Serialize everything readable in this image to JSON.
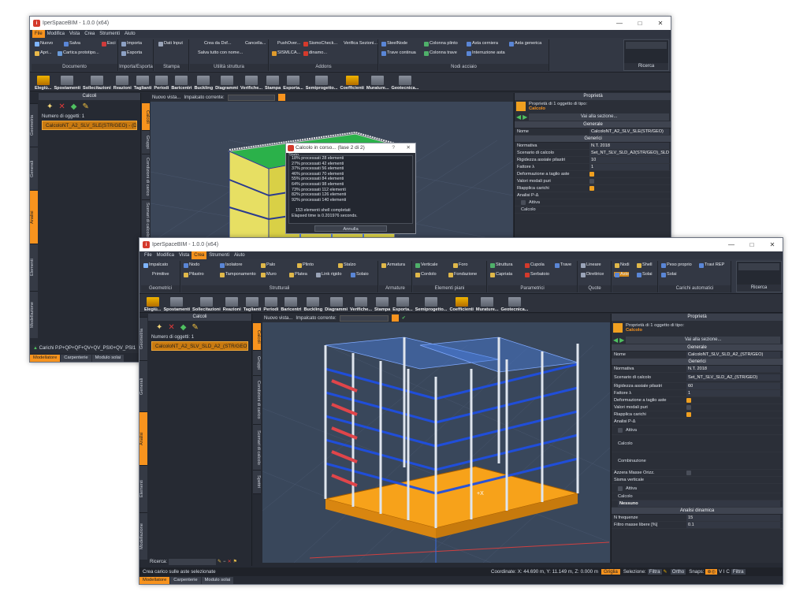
{
  "w1": {
    "title": "IperSpaceBIM - 1.0.0 (x64)",
    "menu": [
      "File",
      "Modifica",
      "Vista",
      "Crea",
      "Strumenti",
      "Aiuto"
    ],
    "ribbon_groups": [
      {
        "label": "Documento",
        "items": [
          "Nuovo",
          "Salva",
          "Esci",
          "Apri...",
          "Cartica prototipo..."
        ]
      },
      {
        "label": "Importa/Esporta",
        "items": [
          "Importa",
          "Esporta"
        ]
      },
      {
        "label": "Stampa",
        "items": [
          "Dati Input"
        ]
      },
      {
        "label": "Utilità struttura",
        "items": [
          "Crea da Dxf...",
          "Cancella...",
          "Salva tutto con nome..."
        ]
      },
      {
        "label": "Addons",
        "items": [
          "PushOver...",
          "SismoCheck...",
          "Verifica Sezioni...",
          "SISMLCA...",
          "dinamo..."
        ]
      },
      {
        "label": "Nodi acciaio",
        "items": [
          "SteelNode",
          "Colonna plinto",
          "Asta cerniera",
          "Asta generica",
          "Trave continua",
          "Colonna trave",
          "Interruzione asta"
        ]
      }
    ],
    "search_label": "Ricerca",
    "toolbar": [
      "Elegiù...",
      "Spostamenti",
      "Sollecitazioni",
      "Reazioni",
      "Taglianti",
      "Periodi",
      "Baricentri",
      "Buckling",
      "Diagrammi",
      "Verifiche...",
      "Stampa",
      "Esporta...",
      "Semiprogetto...",
      "Coefficienti",
      "Murature...",
      "Geotecnica..."
    ],
    "left_panel_title": "Calcoli",
    "left_vtabs": [
      "Geometria",
      "Generali",
      "Analisi",
      "Elementi",
      "Modellazione"
    ],
    "left_vtabs2": [
      "Calcoli",
      "Gruppi",
      "Condizioni di carico",
      "Scenari di calcolo"
    ],
    "object_count": "Numero di oggetti: 1",
    "list_item": "CalcoloNT_A2_SLV_SLE(STR/GEO) - (D",
    "viewport_toolbar": {
      "view": "Nuovo vista...",
      "load": "Impalcato corrente:"
    },
    "props_title": "Proprietà",
    "props_header": "Proprietà di 1 oggetto di tipo:",
    "props_type": "Calcolo",
    "props_button": "Vai alla sezione...",
    "sections": {
      "generale": "Generale",
      "generici": "Generici"
    },
    "props": [
      {
        "k": "Nome",
        "v": "CalcoloNT_A2_SLV_SLE(STR/GEO)"
      },
      {
        "k": "Normativa",
        "v": "N.T. 2018"
      },
      {
        "k": "Scenario di calcolo",
        "v": "Set_NT_SLV_SLD_A2(STR/GEO)_SLD"
      },
      {
        "k": "Rigidezza assiale pilastri",
        "v": "10"
      },
      {
        "k": "Fattore λ",
        "v": "1"
      },
      {
        "k": "Deformazione a taglio aste",
        "v": ""
      },
      {
        "k": "Valori modali puri",
        "v": ""
      },
      {
        "k": "Riapplica carichi",
        "v": ""
      },
      {
        "k": "Analisi P-Δ",
        "v": ""
      }
    ],
    "attiva": "Attiva",
    "calcolo": "Calcolo",
    "bottom_cmd": "Carichi P.P+QP+QF+QV+QV_PSI0+QV_PSI1",
    "tabs": [
      "Modellatore",
      "Carpenterie",
      "Modulo solai"
    ]
  },
  "dialog": {
    "title": "Calcolo in corso... (fase 2 di 2)",
    "state": "Stato",
    "lines": [
      "18% processati    28 elementi",
      "27% processati    42 elementi",
      "37% processati    56 elementi",
      "46% processati    70 elementi",
      "55% processati    84 elementi",
      "64% processati    98 elementi",
      "73% processati   112 elementi",
      "82% processati   126 elementi",
      "92% processati   140 elementi",
      "",
      "153 elementi shell completati",
      "Elapsed time is 0.201976 seconds."
    ],
    "button": "Annulla"
  },
  "w2": {
    "title": "IperSpaceBIM - 1.0.0 (x64)",
    "menu": [
      "File",
      "Modifica",
      "Vista",
      "Crea",
      "Strumenti",
      "Aiuto"
    ],
    "ribbon_groups": [
      {
        "label": "Geometrici",
        "items": [
          "Impalcato",
          "Primitive"
        ]
      },
      {
        "label": "Strutturali",
        "items": [
          "Nodo",
          "Isolatore",
          "Palo",
          "Plinto",
          "Stalzo",
          "Pilastro",
          "Tamponamento",
          "Muro",
          "Platea",
          "Link rigido",
          "Solaio"
        ]
      },
      {
        "label": "Armature",
        "items": [
          "Armatura"
        ]
      },
      {
        "label": "Elementi piani",
        "items": [
          "Verticale",
          "Foro",
          "Cordolo",
          "Fondazione"
        ]
      },
      {
        "label": "Parametrici",
        "items": [
          "Struttura",
          "Cupola",
          "Trave",
          "Capriata",
          "Serbatoio"
        ]
      },
      {
        "label": "Quote",
        "items": [
          "Lineare",
          "Direttrice"
        ]
      },
      {
        "label": "",
        "items": [
          "Nodi",
          "Shell",
          "Aste",
          "Solai"
        ]
      },
      {
        "label": "Carichi automatici",
        "items": [
          "Peso proprio",
          "Travi REP",
          "Solai"
        ]
      }
    ],
    "search_label": "Ricerca",
    "toolbar": [
      "Elegiù...",
      "Spostamenti",
      "Sollecitazioni",
      "Reazioni",
      "Taglianti",
      "Periodi",
      "Baricentri",
      "Buckling",
      "Diagrammi",
      "Verifiche...",
      "Stampa",
      "Esporta...",
      "Semiprogetto...",
      "Coefficienti",
      "Murature...",
      "Geotecnica..."
    ],
    "left_panel_title": "Calcoli",
    "left_vtabs": [
      "Geometria",
      "Generali",
      "Analisi",
      "Elementi",
      "Modellazione"
    ],
    "left_vtabs2": [
      "Calcoli",
      "Gruppi",
      "Condizioni di carico",
      "Scenari di calcolo",
      "Spettri"
    ],
    "object_count": "Numero di oggetti: 1",
    "list_item": "CalcoloNT_A2_SLV_SLD_A2_(STR/GEO) - (D",
    "search": "Ricerca:",
    "viewport_toolbar": {
      "view": "Nuovo vista...",
      "load": "Impalcato corrente:"
    },
    "props_title": "Proprietà",
    "props_header": "Proprietà di 1 oggetto di tipo:",
    "props_type": "Calcolo",
    "props_button": "Vai alla sezione...",
    "sections": {
      "generale": "Generale",
      "generici": "Generici",
      "dinamica": "Analisi dinamica"
    },
    "props": [
      {
        "k": "Nome",
        "v": "CalcoloNT_SLV_SLD_A2_(STR/GEO)"
      },
      {
        "k": "Normativa",
        "v": "N.T. 2018"
      },
      {
        "k": "Scenario di calcolo",
        "v": "Set_NT_SLV_SLD_A2_(STR/GEO)"
      },
      {
        "k": "Rigidezza assiale pilastri",
        "v": "60"
      },
      {
        "k": "Fattore λ",
        "v": "1"
      },
      {
        "k": "Deformazione a taglio aste",
        "v": ""
      },
      {
        "k": "Valori modali puri",
        "v": ""
      },
      {
        "k": "Riapplica carichi",
        "v": ""
      },
      {
        "k": "Analisi P-Δ",
        "v": ""
      }
    ],
    "extra": {
      "attiva": "Attiva",
      "calcolo": "Calcolo",
      "combinazione": "Combinazione",
      "azzera": "Azzera Masse Orizz.",
      "sisma": "Sisma verticale",
      "attiva2": "Attiva",
      "calcolo2": "Calcolo",
      "nessuno": "Nessuno",
      "n_freq_k": "N frequenze",
      "n_freq_v": "15",
      "filtro_k": "Filtro masse libere [%]",
      "filtro_v": "0.1"
    },
    "status_left": "Crea carico sulle aste selezionate",
    "coords": "Coordinate: X: 44.690 m, Y: 11.149 m, Z: 0.000 m",
    "griglia": "Griglia",
    "selezione": "Selezione:",
    "filtra": "Filtra",
    "ortho": "Ortho",
    "snaps": "Snaps:",
    "filtra2": "Filtra",
    "tabs": [
      "Modellatore",
      "Carpenterie",
      "Modulo solai"
    ]
  },
  "colors": {
    "accent": "#f7931e",
    "dark_bg": "#262a33",
    "beam_blue": "#1f4fe0",
    "stair_red": "#e0454a",
    "foundation_orange": "#f7a21a"
  }
}
